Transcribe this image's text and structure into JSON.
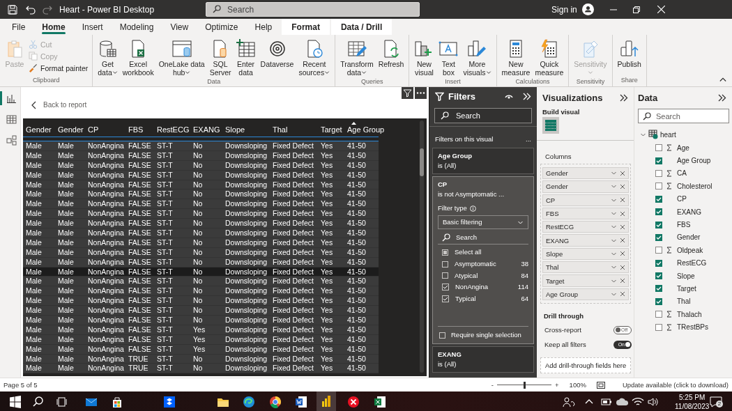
{
  "window": {
    "title": "Heart - Power BI Desktop",
    "search_placeholder": "Search",
    "sign_in": "Sign in"
  },
  "menu_tabs": [
    {
      "label": "File",
      "selected": false,
      "contextual": false
    },
    {
      "label": "Home",
      "selected": true,
      "contextual": false
    },
    {
      "label": "Insert",
      "selected": false,
      "contextual": false
    },
    {
      "label": "Modeling",
      "selected": false,
      "contextual": false
    },
    {
      "label": "View",
      "selected": false,
      "contextual": false
    },
    {
      "label": "Optimize",
      "selected": false,
      "contextual": false
    },
    {
      "label": "Help",
      "selected": false,
      "contextual": false
    },
    {
      "label": "Format",
      "selected": false,
      "contextual": true
    },
    {
      "label": "Data / Drill",
      "selected": false,
      "contextual": true
    }
  ],
  "ribbon_groups": [
    {
      "label": "Clipboard",
      "buttons": [
        {
          "kind": "large",
          "lines": [
            "Paste"
          ],
          "dropdown": false,
          "disabled": true
        },
        {
          "kind": "small",
          "lines": [
            "Cut"
          ],
          "dropdown": false,
          "disabled": true
        },
        {
          "kind": "small",
          "lines": [
            "Copy"
          ],
          "dropdown": false,
          "disabled": true
        },
        {
          "kind": "small",
          "lines": [
            "Format painter"
          ],
          "dropdown": false,
          "disabled": false
        }
      ]
    },
    {
      "label": "Data",
      "buttons": [
        {
          "kind": "large",
          "lines": [
            "Get",
            "data"
          ],
          "dropdown": true,
          "disabled": false
        },
        {
          "kind": "large",
          "lines": [
            "Excel",
            "workbook"
          ],
          "dropdown": false,
          "disabled": false
        },
        {
          "kind": "large",
          "lines": [
            "OneLake data",
            "hub"
          ],
          "dropdown": true,
          "disabled": false
        },
        {
          "kind": "large",
          "lines": [
            "SQL",
            "Server"
          ],
          "dropdown": false,
          "disabled": false
        },
        {
          "kind": "large",
          "lines": [
            "Enter",
            "data"
          ],
          "dropdown": false,
          "disabled": false
        },
        {
          "kind": "large",
          "lines": [
            "Dataverse"
          ],
          "dropdown": false,
          "disabled": false
        },
        {
          "kind": "large",
          "lines": [
            "Recent",
            "sources"
          ],
          "dropdown": true,
          "disabled": false
        }
      ]
    },
    {
      "label": "Queries",
      "buttons": [
        {
          "kind": "large",
          "lines": [
            "Transform",
            "data"
          ],
          "dropdown": true,
          "disabled": false
        },
        {
          "kind": "large",
          "lines": [
            "Refresh"
          ],
          "dropdown": false,
          "disabled": false
        }
      ]
    },
    {
      "label": "Insert",
      "buttons": [
        {
          "kind": "large",
          "lines": [
            "New",
            "visual"
          ],
          "dropdown": false,
          "disabled": false
        },
        {
          "kind": "large",
          "lines": [
            "Text",
            "box"
          ],
          "dropdown": false,
          "disabled": false
        },
        {
          "kind": "large",
          "lines": [
            "More",
            "visuals"
          ],
          "dropdown": true,
          "disabled": false
        }
      ]
    },
    {
      "label": "Calculations",
      "buttons": [
        {
          "kind": "large",
          "lines": [
            "New",
            "measure"
          ],
          "dropdown": false,
          "disabled": false
        },
        {
          "kind": "large",
          "lines": [
            "Quick",
            "measure"
          ],
          "dropdown": false,
          "disabled": false
        }
      ]
    },
    {
      "label": "Sensitivity",
      "buttons": [
        {
          "kind": "large",
          "lines": [
            "Sensitivity"
          ],
          "dropdown": true,
          "disabled": true
        }
      ]
    },
    {
      "label": "Share",
      "buttons": [
        {
          "kind": "large",
          "lines": [
            "Publish"
          ],
          "dropdown": false,
          "disabled": false
        }
      ]
    }
  ],
  "views": [
    {
      "selected": true
    },
    {
      "selected": false
    },
    {
      "selected": false
    }
  ],
  "canvas": {
    "back_link": "Back to report"
  },
  "table": {
    "columns": [
      {
        "label": "Gender",
        "sorted": false
      },
      {
        "label": "Gender",
        "sorted": false
      },
      {
        "label": "CP",
        "sorted": false
      },
      {
        "label": "FBS",
        "sorted": false
      },
      {
        "label": "RestECG",
        "sorted": false
      },
      {
        "label": "EXANG",
        "sorted": false
      },
      {
        "label": "Slope",
        "sorted": false
      },
      {
        "label": "Thal",
        "sorted": false
      },
      {
        "label": "Target",
        "sorted": false
      },
      {
        "label": "Age Group",
        "sorted": true
      }
    ],
    "rows": [
      {
        "cells": [
          "Male",
          "Male",
          "NonAngina",
          "FALSE",
          "ST-T",
          "No",
          "Downsloping",
          "Fixed Defect",
          "Yes",
          "41-50"
        ],
        "hovered": false
      },
      {
        "cells": [
          "Male",
          "Male",
          "NonAngina",
          "FALSE",
          "ST-T",
          "No",
          "Downsloping",
          "Fixed Defect",
          "Yes",
          "41-50"
        ],
        "hovered": false
      },
      {
        "cells": [
          "Male",
          "Male",
          "NonAngina",
          "FALSE",
          "ST-T",
          "No",
          "Downsloping",
          "Fixed Defect",
          "Yes",
          "41-50"
        ],
        "hovered": false
      },
      {
        "cells": [
          "Male",
          "Male",
          "NonAngina",
          "FALSE",
          "ST-T",
          "No",
          "Downsloping",
          "Fixed Defect",
          "Yes",
          "41-50"
        ],
        "hovered": false
      },
      {
        "cells": [
          "Male",
          "Male",
          "NonAngina",
          "FALSE",
          "ST-T",
          "No",
          "Downsloping",
          "Fixed Defect",
          "Yes",
          "41-50"
        ],
        "hovered": false
      },
      {
        "cells": [
          "Male",
          "Male",
          "NonAngina",
          "FALSE",
          "ST-T",
          "No",
          "Downsloping",
          "Fixed Defect",
          "Yes",
          "41-50"
        ],
        "hovered": false
      },
      {
        "cells": [
          "Male",
          "Male",
          "NonAngina",
          "FALSE",
          "ST-T",
          "No",
          "Downsloping",
          "Fixed Defect",
          "Yes",
          "41-50"
        ],
        "hovered": false
      },
      {
        "cells": [
          "Male",
          "Male",
          "NonAngina",
          "FALSE",
          "ST-T",
          "No",
          "Downsloping",
          "Fixed Defect",
          "Yes",
          "41-50"
        ],
        "hovered": false
      },
      {
        "cells": [
          "Male",
          "Male",
          "NonAngina",
          "FALSE",
          "ST-T",
          "No",
          "Downsloping",
          "Fixed Defect",
          "Yes",
          "41-50"
        ],
        "hovered": false
      },
      {
        "cells": [
          "Male",
          "Male",
          "NonAngina",
          "FALSE",
          "ST-T",
          "No",
          "Downsloping",
          "Fixed Defect",
          "Yes",
          "41-50"
        ],
        "hovered": false
      },
      {
        "cells": [
          "Male",
          "Male",
          "NonAngina",
          "FALSE",
          "ST-T",
          "No",
          "Downsloping",
          "Fixed Defect",
          "Yes",
          "41-50"
        ],
        "hovered": false
      },
      {
        "cells": [
          "Male",
          "Male",
          "NonAngina",
          "FALSE",
          "ST-T",
          "No",
          "Downsloping",
          "Fixed Defect",
          "Yes",
          "41-50"
        ],
        "hovered": false
      },
      {
        "cells": [
          "Male",
          "Male",
          "NonAngina",
          "FALSE",
          "ST-T",
          "No",
          "Downsloping",
          "Fixed Defect",
          "Yes",
          "41-50"
        ],
        "hovered": false
      },
      {
        "cells": [
          "Male",
          "Male",
          "NonAngina",
          "FALSE",
          "ST-T",
          "No",
          "Downsloping",
          "Fixed Defect",
          "Yes",
          "41-50"
        ],
        "hovered": true
      },
      {
        "cells": [
          "Male",
          "Male",
          "NonAngina",
          "FALSE",
          "ST-T",
          "No",
          "Downsloping",
          "Fixed Defect",
          "Yes",
          "41-50"
        ],
        "hovered": false
      },
      {
        "cells": [
          "Male",
          "Male",
          "NonAngina",
          "FALSE",
          "ST-T",
          "No",
          "Downsloping",
          "Fixed Defect",
          "Yes",
          "41-50"
        ],
        "hovered": false
      },
      {
        "cells": [
          "Male",
          "Male",
          "NonAngina",
          "FALSE",
          "ST-T",
          "No",
          "Downsloping",
          "Fixed Defect",
          "Yes",
          "41-50"
        ],
        "hovered": false
      },
      {
        "cells": [
          "Male",
          "Male",
          "NonAngina",
          "FALSE",
          "ST-T",
          "No",
          "Downsloping",
          "Fixed Defect",
          "Yes",
          "41-50"
        ],
        "hovered": false
      },
      {
        "cells": [
          "Male",
          "Male",
          "NonAngina",
          "FALSE",
          "ST-T",
          "No",
          "Downsloping",
          "Fixed Defect",
          "Yes",
          "41-50"
        ],
        "hovered": false
      },
      {
        "cells": [
          "Male",
          "Male",
          "NonAngina",
          "FALSE",
          "ST-T",
          "Yes",
          "Downsloping",
          "Fixed Defect",
          "Yes",
          "41-50"
        ],
        "hovered": false
      },
      {
        "cells": [
          "Male",
          "Male",
          "NonAngina",
          "FALSE",
          "ST-T",
          "Yes",
          "Downsloping",
          "Fixed Defect",
          "Yes",
          "41-50"
        ],
        "hovered": false
      },
      {
        "cells": [
          "Male",
          "Male",
          "NonAngina",
          "FALSE",
          "ST-T",
          "Yes",
          "Downsloping",
          "Fixed Defect",
          "Yes",
          "41-50"
        ],
        "hovered": false
      },
      {
        "cells": [
          "Male",
          "Male",
          "NonAngina",
          "TRUE",
          "ST-T",
          "No",
          "Downsloping",
          "Fixed Defect",
          "Yes",
          "41-50"
        ],
        "hovered": false
      },
      {
        "cells": [
          "Male",
          "Male",
          "NonAngina",
          "TRUE",
          "ST-T",
          "No",
          "Downsloping",
          "Fixed Defect",
          "Yes",
          "41-50"
        ],
        "hovered": false
      }
    ]
  },
  "filters": {
    "title": "Filters",
    "search_placeholder": "Search",
    "section": "Filters on this visual",
    "more": "...",
    "cards": [
      {
        "field": "Age Group",
        "summary": "is (All)",
        "expanded": false
      },
      {
        "field": "CP",
        "summary": "is not Asymptomatic ...",
        "expanded": true,
        "filter_type_label": "Filter type",
        "filter_type": "Basic filtering",
        "search_placeholder": "Search",
        "select_all": {
          "label": "Select all",
          "partial": true
        },
        "options": [
          {
            "label": "Asymptomatic",
            "count": "38",
            "checked": false
          },
          {
            "label": "Atypical",
            "count": "84",
            "checked": false
          },
          {
            "label": "NonAngina",
            "count": "114",
            "checked": true
          },
          {
            "label": "Typical",
            "count": "64",
            "checked": true
          }
        ],
        "single_selection": {
          "label": "Require single selection",
          "checked": false
        }
      },
      {
        "field": "EXANG",
        "summary": "is (All)",
        "expanded": false
      }
    ]
  },
  "visualizations": {
    "title": "Visualizations",
    "build_visual": "Build visual",
    "wells_label": "Columns",
    "wells": [
      "Gender",
      "Gender",
      "CP",
      "FBS",
      "RestECG",
      "EXANG",
      "Slope",
      "Thal",
      "Target",
      "Age Group"
    ],
    "drill_through": "Drill through",
    "toggles": [
      {
        "label": "Cross-report",
        "on": false,
        "state_text": "Off"
      },
      {
        "label": "Keep all filters",
        "on": true,
        "state_text": "On"
      }
    ],
    "drop_zone": "Add drill-through fields here"
  },
  "data": {
    "title": "Data",
    "search_placeholder": "Search",
    "table": {
      "name": "heart",
      "expanded": true,
      "children": [
        {
          "name": "Age",
          "kind": "numeric",
          "checked": false
        },
        {
          "name": "Age Group",
          "kind": "text",
          "checked": true
        },
        {
          "name": "CA",
          "kind": "numeric",
          "checked": false
        },
        {
          "name": "Cholesterol",
          "kind": "numeric",
          "checked": false
        },
        {
          "name": "CP",
          "kind": "text",
          "checked": true
        },
        {
          "name": "EXANG",
          "kind": "text",
          "checked": true
        },
        {
          "name": "FBS",
          "kind": "text",
          "checked": true
        },
        {
          "name": "Gender",
          "kind": "text",
          "checked": true
        },
        {
          "name": "Oldpeak",
          "kind": "numeric",
          "checked": false
        },
        {
          "name": "RestECG",
          "kind": "text",
          "checked": true
        },
        {
          "name": "Slope",
          "kind": "text",
          "checked": true
        },
        {
          "name": "Target",
          "kind": "text",
          "checked": true
        },
        {
          "name": "Thal",
          "kind": "text",
          "checked": true
        },
        {
          "name": "Thalach",
          "kind": "numeric",
          "checked": false
        },
        {
          "name": "TRestBPs",
          "kind": "numeric",
          "checked": false
        }
      ]
    }
  },
  "status_bar": {
    "page": "Page 5 of 5",
    "zoom_out": "-",
    "zoom_in": "+",
    "level": 0.5,
    "zoom": "100%",
    "update": "Update available (click to download)"
  },
  "taskbar": {
    "apps": [
      {
        "active": false
      },
      {
        "active": false
      },
      {
        "active": false
      },
      {
        "active": false
      },
      {
        "active": false
      },
      {
        "active": false
      },
      {
        "active": false
      },
      {
        "active": true
      },
      {
        "active": false
      },
      {
        "active": false
      }
    ],
    "time": "5:25 PM",
    "date": "11/08/2023",
    "notifications": "2"
  }
}
